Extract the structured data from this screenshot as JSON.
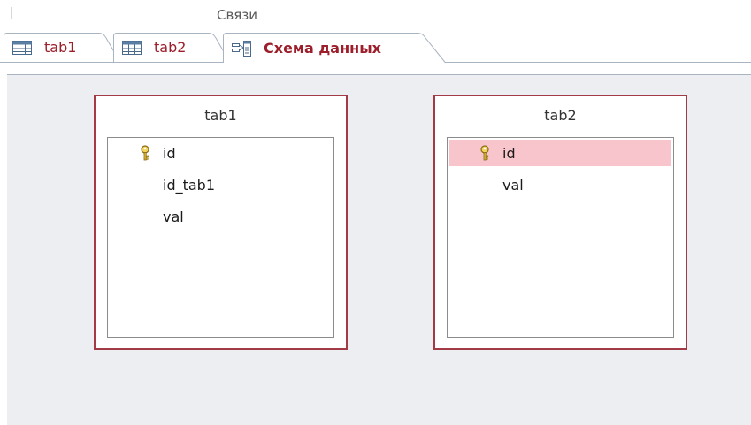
{
  "ribbon": {
    "group_label": "Связи"
  },
  "tabs": [
    {
      "label": "tab1",
      "icon": "table-icon",
      "active": false
    },
    {
      "label": "tab2",
      "icon": "table-icon",
      "active": false
    },
    {
      "label": "Схема данных",
      "icon": "relationships-icon",
      "active": true
    }
  ],
  "diagram": {
    "tables": [
      {
        "title": "tab1",
        "fields": [
          {
            "name": "id",
            "primary_key": true,
            "selected": false
          },
          {
            "name": "id_tab1",
            "primary_key": false,
            "selected": false
          },
          {
            "name": "val",
            "primary_key": false,
            "selected": false
          }
        ]
      },
      {
        "title": "tab2",
        "fields": [
          {
            "name": "id",
            "primary_key": true,
            "selected": true
          },
          {
            "name": "val",
            "primary_key": false,
            "selected": false
          }
        ]
      }
    ]
  },
  "colors": {
    "accent": "#9c1e2b",
    "table_border": "#a33b47",
    "selection": "#f7c5cb",
    "canvas": "#eceef1"
  }
}
